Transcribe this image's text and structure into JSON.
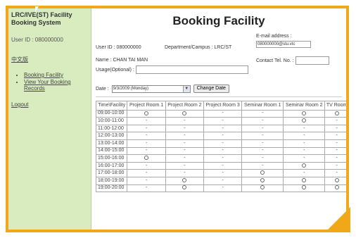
{
  "sidebar": {
    "title": "LRC/IVE(ST) Facility Booking System",
    "user_id": "User ID : 080000000",
    "language_link": "中文版",
    "menu": [
      {
        "label": "Booking Facility"
      },
      {
        "label": "View Your Booking Records"
      }
    ],
    "logout": "Logout"
  },
  "header": {
    "title": "Booking Facility"
  },
  "info": {
    "user_id": "User ID : 080000000",
    "department": "Department/Campus : LRC/ST",
    "email_label": "E-mail address :",
    "email_value": "080000000@stu.vtc",
    "name": "Name : CHAN TAI MAN",
    "tel_label": "Contact Tel. No. :",
    "usage_label": "Usage(Optional) :"
  },
  "date_picker": {
    "label": "Date :",
    "value": "9/3/2009 (Monday)",
    "button": "Change Date"
  },
  "table": {
    "headers": [
      "Time\\Facility",
      "Project Room 1",
      "Project Room 2",
      "Project Room 3",
      "Seminar Room 1",
      "Seminar Room 2",
      "TV Room"
    ],
    "rows": [
      {
        "time": "09:00-10:00",
        "cells": [
          "o",
          "o",
          "-",
          "-",
          "o",
          "o"
        ]
      },
      {
        "time": "10:00-11:00",
        "cells": [
          "-",
          "-",
          "-",
          "-",
          "o",
          "-"
        ]
      },
      {
        "time": "11:00-12:00",
        "cells": [
          "-",
          "-",
          "-",
          "-",
          "-",
          "-"
        ]
      },
      {
        "time": "12:00-13:00",
        "cells": [
          "-",
          "-",
          "-",
          "-",
          "-",
          "-"
        ]
      },
      {
        "time": "13:00-14:00",
        "cells": [
          "-",
          "-",
          "-",
          "-",
          "-",
          "-"
        ]
      },
      {
        "time": "14:00-15:00",
        "cells": [
          "-",
          "-",
          "-",
          "-",
          "-",
          "-"
        ]
      },
      {
        "time": "15:00-16:00",
        "cells": [
          "o",
          "-",
          "-",
          "-",
          "-",
          "-"
        ]
      },
      {
        "time": "16:00-17:00",
        "cells": [
          "-",
          "-",
          "-",
          "-",
          "o",
          "-"
        ]
      },
      {
        "time": "17:00-18:00",
        "cells": [
          "-",
          "-",
          "-",
          "o",
          "-",
          "-"
        ]
      },
      {
        "time": "18:00-19:00",
        "cells": [
          "-",
          "o",
          "-",
          "o",
          "o",
          "o"
        ]
      },
      {
        "time": "19:00-20:00",
        "cells": [
          "-",
          "o",
          "-",
          "o",
          "o",
          "o"
        ]
      }
    ]
  },
  "colors": {
    "frame": "#f0a818",
    "sidebar": "#d8ecc0"
  }
}
